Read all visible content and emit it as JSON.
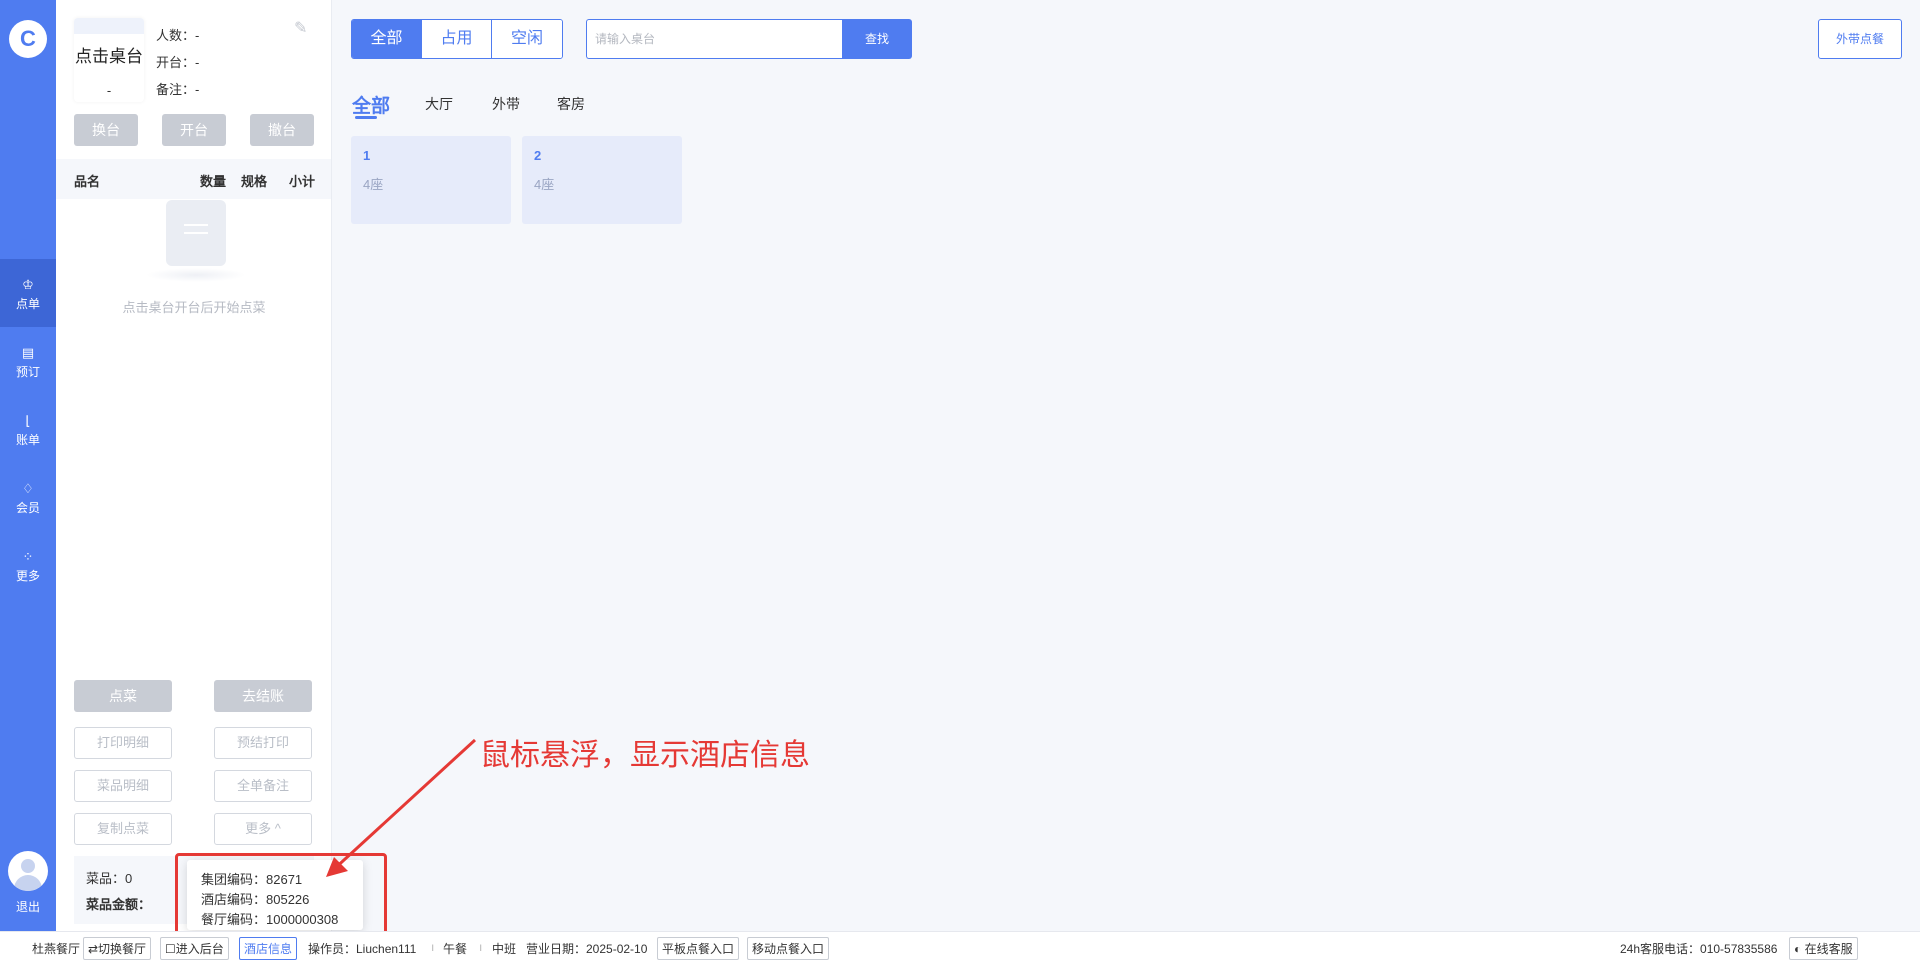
{
  "nav": {
    "logo_glyph": "C",
    "items": [
      {
        "label": "点单",
        "icon": "chef-hat-icon",
        "glyph": "♔"
      },
      {
        "label": "预订",
        "icon": "book-icon",
        "glyph": "▤"
      },
      {
        "label": "账单",
        "icon": "chart-icon",
        "glyph": "⌊"
      },
      {
        "label": "会员",
        "icon": "diamond-icon",
        "glyph": "♢"
      },
      {
        "label": "更多",
        "icon": "grid-icon",
        "glyph": "⁘"
      }
    ],
    "logout": "退出"
  },
  "panel": {
    "table_card": {
      "name": "点击桌台",
      "sub": "-"
    },
    "info": {
      "people": "人数：-",
      "open": "开台：-",
      "note": "备注：-"
    },
    "top_buttons": {
      "swap": "换台",
      "open": "开台",
      "cancel": "撤台"
    },
    "list_headers": {
      "name": "品名",
      "qty": "数量",
      "spec": "规格",
      "subtotal": "小计"
    },
    "empty_text": "点击桌台开台后开始点菜",
    "buttons": {
      "order": "点菜",
      "checkout": "去结账",
      "print_detail": "打印明细",
      "pre_print": "预结打印",
      "dish_detail": "菜品明细",
      "order_note": "全单备注",
      "copy_order": "复制点菜",
      "more": "更多 ^"
    },
    "summary": {
      "dishes": "菜品：0",
      "amount": "菜品金额："
    }
  },
  "main": {
    "segments": [
      "全部",
      "占用",
      "空闲"
    ],
    "segment_active": 0,
    "search_placeholder": "请输入桌台",
    "search_button": "查找",
    "takeout_button": "外带点餐",
    "area_tabs": [
      "全部",
      "大厅",
      "外带",
      "客房"
    ],
    "tables": [
      {
        "num": "1",
        "seats": "4座"
      },
      {
        "num": "2",
        "seats": "4座"
      }
    ]
  },
  "popup": {
    "group_code": "集团编码：82671",
    "hotel_code": "酒店编码：805226",
    "restaurant_code": "餐厅编码：1000000308"
  },
  "annotation": "鼠标悬浮，显示酒店信息",
  "statusbar": {
    "restaurant": "杜燕餐厅",
    "switch": "⇄切换餐厅",
    "backend": "☐进入后台",
    "hotel_info": "酒店信息",
    "operator": "操作员：Liuchen111",
    "meal": "午餐",
    "shift": "中班",
    "business_date": "营业日期：2025-02-10",
    "tablet_entry": "平板点餐入口",
    "mobile_entry": "移动点餐入口",
    "hotline": "24h客服电话：010-57835586",
    "online_service": "◐ 在线客服"
  },
  "colors": {
    "accent": "#4f7cf0",
    "annotation_red": "#e53935"
  }
}
